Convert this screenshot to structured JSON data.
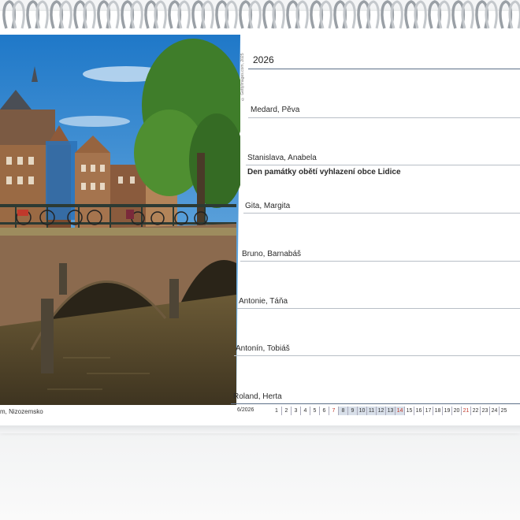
{
  "calendar": {
    "year": "2026",
    "photo_caption": "m, Nizozemsko",
    "photo_credit": "© GettyImages.com, 2025",
    "days": [
      {
        "names": "Medard, Pěva"
      },
      {
        "names": "Stanislava, Anabela",
        "note": "Den památky obětí vyhlazení obce Lidice"
      },
      {
        "names": "Gita, Margita"
      },
      {
        "names": "Bruno, Barnabáš"
      },
      {
        "names": "Antonie, Táňa"
      },
      {
        "names": "Antonín, Tobiáš"
      },
      {
        "names": "Roland, Herta"
      }
    ],
    "month_label": "6/2026",
    "mini_calendar": [
      "1",
      "2",
      "3",
      "4",
      "5",
      "6",
      "7",
      "8",
      "9",
      "10",
      "11",
      "12",
      "13",
      "14",
      "15",
      "16",
      "17",
      "18",
      "19",
      "20",
      "21",
      "22",
      "23",
      "24",
      "25"
    ],
    "mini_calendar_red": [
      "7",
      "14",
      "21"
    ],
    "mini_calendar_highlighted": [
      "8",
      "9",
      "10",
      "11",
      "12",
      "13",
      "14"
    ]
  },
  "colors": {
    "sky": "#2f8fd6",
    "water": "#5b4a2c",
    "brick": "#9a6a44",
    "foliage": "#3f7d2a",
    "rule": "#5c6f88"
  }
}
